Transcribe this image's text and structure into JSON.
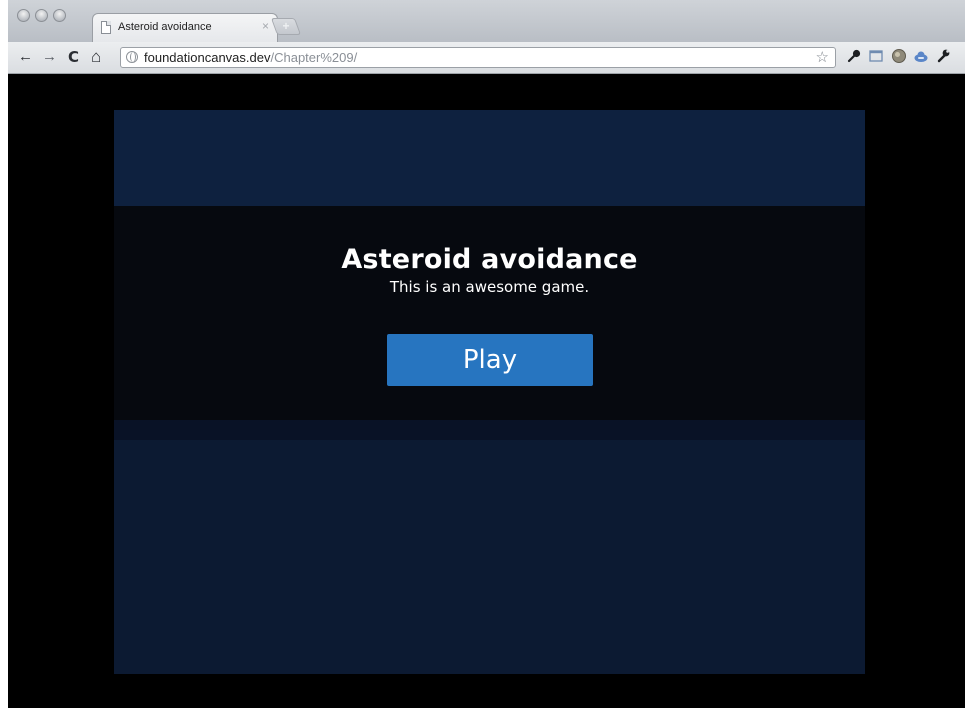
{
  "browser": {
    "tab": {
      "title": "Asteroid avoidance",
      "close_glyph": "×",
      "icon": "page-icon"
    },
    "new_tab_glyph": "+",
    "nav": {
      "back_glyph": "←",
      "forward_glyph": "→",
      "reload_glyph": "C",
      "home_glyph": "⌂"
    },
    "address": {
      "host": "foundationcanvas.dev",
      "path": "/Chapter%209/"
    },
    "bookmark_star_glyph": "☆",
    "toolbar_icons": [
      "pin-icon",
      "window-icon",
      "extension-globe-icon",
      "cloud-icon",
      "wrench-icon"
    ]
  },
  "game": {
    "title": "Asteroid avoidance",
    "subtitle": "This is an awesome game.",
    "play_label": "Play"
  },
  "colors": {
    "play_button": "#2775c0",
    "canvas_background": "#0b1a33",
    "overlay": "#06090f",
    "page_background": "#000000"
  }
}
